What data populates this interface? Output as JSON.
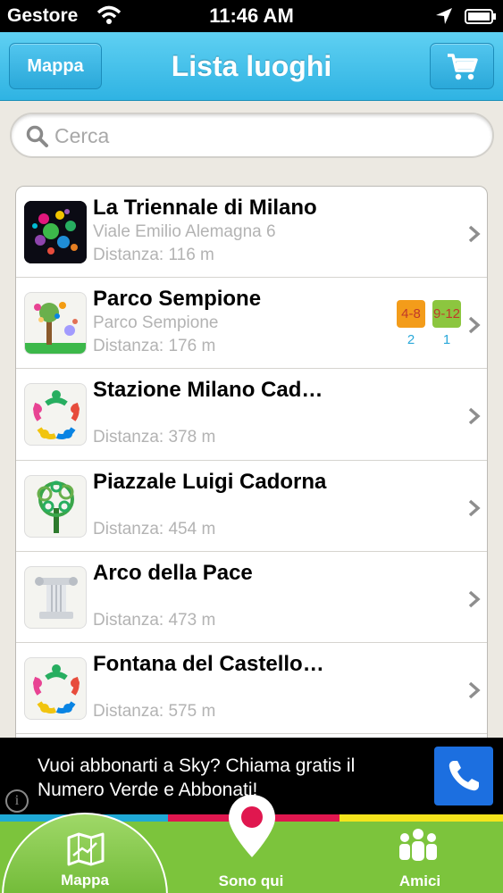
{
  "status_bar": {
    "carrier": "Gestore",
    "time": "11:46 AM"
  },
  "nav": {
    "title": "Lista luoghi",
    "left_button": "Mappa",
    "right_icon": "cart-icon"
  },
  "search": {
    "placeholder": "Cerca",
    "value": ""
  },
  "places": [
    {
      "name": "La Triennale di Milano",
      "address": "Viale Emilio Alemagna 6",
      "distance": "Distanza: 116 m",
      "icon": "triennale-logo"
    },
    {
      "name": "Parco Sempione",
      "address": "Parco Sempione",
      "distance": "Distanza: 176 m",
      "icon": "park-tree-logo",
      "age_badges": [
        {
          "label": "4-8",
          "count": "2",
          "color": "#f39c1a"
        },
        {
          "label": "9-12",
          "count": "1",
          "color": "#8cc63f"
        }
      ]
    },
    {
      "name": "Stazione Milano Cad…",
      "address": "",
      "distance": "Distanza: 378 m",
      "icon": "people-circle-logo"
    },
    {
      "name": "Piazzale Luigi Cadorna",
      "address": "",
      "distance": "Distanza: 454 m",
      "icon": "tree-logo"
    },
    {
      "name": "Arco della Pace",
      "address": "",
      "distance": "Distanza: 473 m",
      "icon": "column-logo"
    },
    {
      "name": "Fontana del Castello…",
      "address": "",
      "distance": "Distanza: 575 m",
      "icon": "people-circle-logo"
    }
  ],
  "ad": {
    "text": "Vuoi abbonarti a Sky? Chiama gratis il Numero Verde e Abbonati!",
    "info": "i"
  },
  "tabs": [
    {
      "label": "Mappa",
      "icon": "map-icon",
      "active": true
    },
    {
      "label": "Sono qui",
      "icon": "pin-icon",
      "active": false
    },
    {
      "label": "Amici",
      "icon": "people-icon",
      "active": false
    }
  ],
  "colors": {
    "nav": "#2fb3e3",
    "tabbar": "#7cc43c",
    "strip": [
      "#1fa9d6",
      "#e0174f",
      "#f4e41c"
    ]
  }
}
